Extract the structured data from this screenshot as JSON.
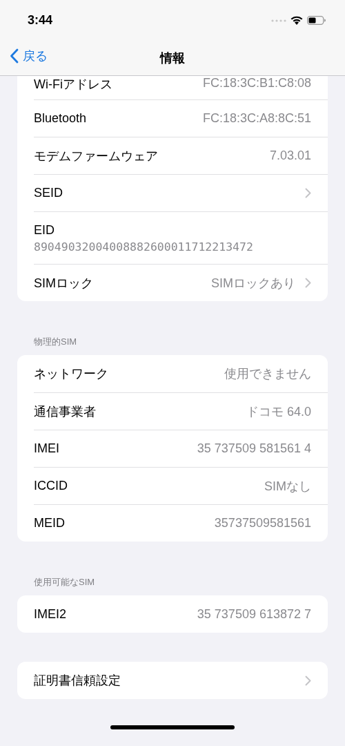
{
  "status_bar": {
    "time": "3:44"
  },
  "nav": {
    "back": "戻る",
    "title": "情報"
  },
  "groups": [
    {
      "rows": [
        {
          "kind": "value",
          "label": "Wi-Fiアドレス",
          "value": "FC:18:3C:B1:C8:08"
        },
        {
          "kind": "value",
          "label": "Bluetooth",
          "value": "FC:18:3C:A8:8C:51"
        },
        {
          "kind": "value",
          "label": "モデムファームウェア",
          "value": "7.03.01"
        },
        {
          "kind": "link",
          "label": "SEID"
        },
        {
          "kind": "stacked",
          "label": "EID",
          "value": "89049032004008882600011712213472"
        },
        {
          "kind": "link",
          "label": "SIMロック",
          "value": "SIMロックあり"
        }
      ]
    },
    {
      "header": "物理的SIM",
      "rows": [
        {
          "kind": "value",
          "label": "ネットワーク",
          "value": "使用できません"
        },
        {
          "kind": "value",
          "label": "通信事業者",
          "value": "ドコモ 64.0"
        },
        {
          "kind": "value",
          "label": "IMEI",
          "value": "35 737509 581561 4"
        },
        {
          "kind": "value",
          "label": "ICCID",
          "value": "SIMなし"
        },
        {
          "kind": "value",
          "label": "MEID",
          "value": "35737509581561"
        }
      ]
    },
    {
      "header": "使用可能なSIM",
      "rows": [
        {
          "kind": "value",
          "label": "IMEI2",
          "value": "35 737509 613872 7"
        }
      ]
    },
    {
      "rows": [
        {
          "kind": "link",
          "label": "証明書信頼設定"
        }
      ]
    }
  ]
}
